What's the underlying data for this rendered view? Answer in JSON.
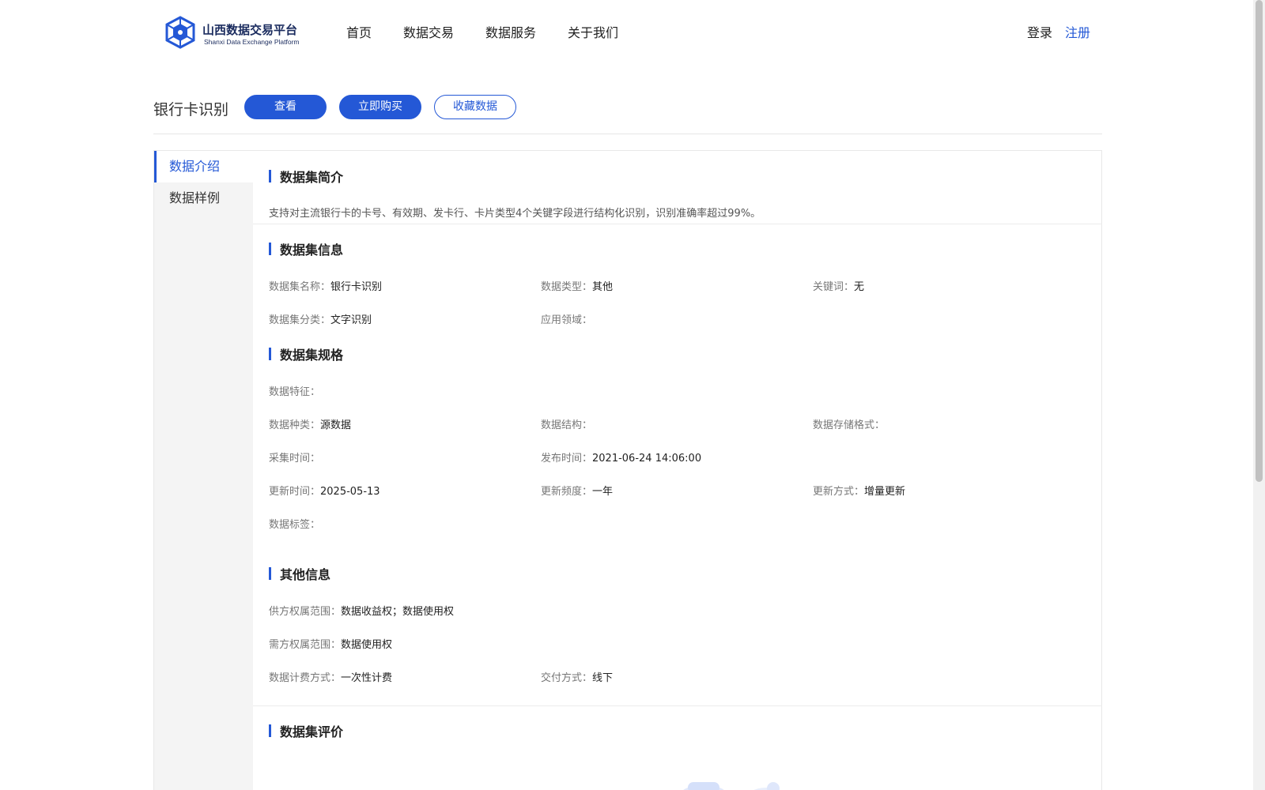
{
  "header": {
    "logo_title": "山西数据交易平台",
    "logo_subtitle": "Shanxi Data Exchange Platform",
    "nav": [
      "首页",
      "数据交易",
      "数据服务",
      "关于我们"
    ],
    "login": "登录",
    "register": "注册"
  },
  "titlebar": {
    "title": "银行卡识别",
    "view": "查看",
    "buy": "立即购买",
    "favorite": "收藏数据"
  },
  "sidebar": {
    "items": [
      "数据介绍",
      "数据样例"
    ]
  },
  "sections": {
    "intro": {
      "heading": "数据集简介",
      "text": "支持对主流银行卡的卡号、有效期、发卡行、卡片类型4个关键字段进行结构化识别，识别准确率超过99%。"
    },
    "info": {
      "heading": "数据集信息",
      "name_label": "数据集名称：",
      "name_value": "银行卡识别",
      "type_label": "数据类型：",
      "type_value": "其他",
      "keyword_label": "关键词：",
      "keyword_value": "无",
      "category_label": "数据集分类：",
      "category_value": "文字识别",
      "domain_label": "应用领域：",
      "domain_value": ""
    },
    "spec": {
      "heading": "数据集规格",
      "feature_label": "数据特征：",
      "feature_value": "",
      "kind_label": "数据种类：",
      "kind_value": "源数据",
      "structure_label": "数据结构：",
      "structure_value": "",
      "storage_label": "数据存储格式：",
      "storage_value": "",
      "collect_label": "采集时间：",
      "collect_value": "",
      "publish_label": "发布时间：",
      "publish_value": "2021-06-24 14:06:00",
      "update_label": "更新时间：",
      "update_value": "2025-05-13",
      "frequency_label": "更新频度：",
      "frequency_value": "一年",
      "method_label": "更新方式：",
      "method_value": "增量更新",
      "tags_label": "数据标签：",
      "tags_value": ""
    },
    "other": {
      "heading": "其他信息",
      "supply_label": "供方权属范围：",
      "supply_value": "数据收益权；数据使用权",
      "demand_label": "需方权属范围：",
      "demand_value": "数据使用权",
      "billing_label": "数据计费方式：",
      "billing_value": "一次性计费",
      "delivery_label": "交付方式：",
      "delivery_value": "线下"
    },
    "evaluation": {
      "heading": "数据集评价"
    }
  },
  "colors": {
    "accent": "#2458d6",
    "logo_navy": "#1a2b5e"
  }
}
